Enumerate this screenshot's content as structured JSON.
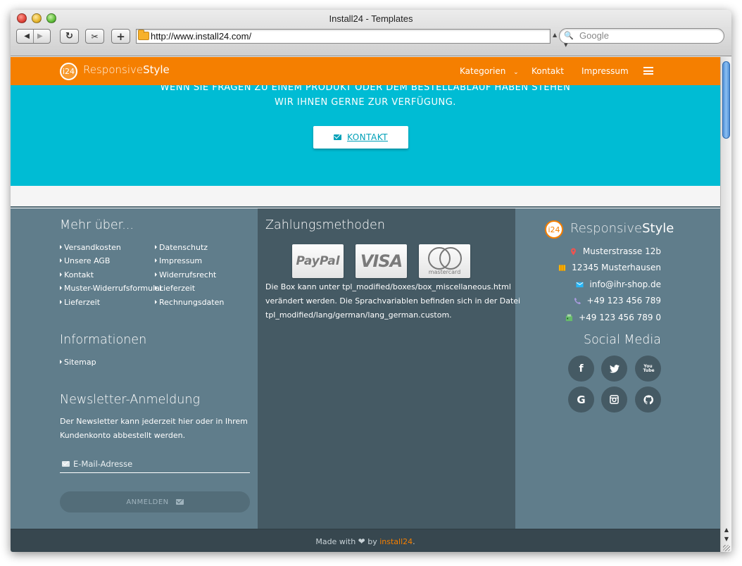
{
  "window": {
    "title": "Install24 - Templates",
    "url": "http://www.install24.com/",
    "search_placeholder": "Google"
  },
  "navbar": {
    "logo_text": "i24",
    "brand_light": "Responsive",
    "brand_bold": "Style",
    "links": {
      "kategorien": "Kategorien",
      "kontakt": "Kontakt",
      "impressum": "Impressum"
    }
  },
  "banner": {
    "line1": "WENN SIE FRAGEN ZU EINEM PRODUKT ODER DEM BESTELLABLAUF HABEN STEHEN",
    "line2": "WIR IHNEN GERNE ZUR VERFÜGUNG.",
    "button_label": "KONTAKT"
  },
  "footer": {
    "more": {
      "title": "Mehr über...",
      "links": [
        "Versandkosten",
        "Datenschutz",
        "Unsere AGB",
        "Impressum",
        "Kontakt",
        "Widerrufsrecht",
        "Muster-Widerrufsformular",
        "Lieferzeit",
        "Lieferzeit",
        "Rechnungsdaten"
      ]
    },
    "info": {
      "title": "Informationen",
      "links": [
        "Sitemap"
      ]
    },
    "newsletter": {
      "title": "Newsletter-Anmeldung",
      "text_line1": "Der Newsletter kann jederzeit hier oder in Ihrem",
      "text_line2": "Kundenkonto abbestellt werden.",
      "email_placeholder": "E-Mail-Adresse",
      "button_label": "ANMELDEN"
    },
    "payment": {
      "title": "Zahlungsmethoden",
      "logos": {
        "paypal": "PayPal",
        "visa": "VISA",
        "mastercard": "mastercard"
      },
      "text_line1": "Die Box kann unter tpl_modified/boxes/box_miscellaneous.html",
      "text_line2": "verändert werden. Die Sprachvariablen befinden sich in der Datei",
      "text_line3": "tpl_modified/lang/german/lang_german.custom."
    },
    "contact": {
      "logo_text": "i24",
      "brand_light": "Responsive",
      "brand_bold": "Style",
      "street": "Musterstrasse 12b",
      "city": "12345 Musterhausen",
      "email": "info@ihr-shop.de",
      "phone": "+49 123 456 789",
      "fax": "+49 123 456 789 0"
    },
    "social": {
      "title": "Social Media",
      "icons": [
        "facebook-icon",
        "twitter-icon",
        "youtube-icon",
        "google-icon",
        "instagram-icon",
        "github-icon"
      ],
      "glyphs": {
        "facebook": "f",
        "google": "G",
        "youtube": "You Tube"
      }
    },
    "bottom": {
      "made_with": "Made with",
      "by": "by",
      "link": "install24",
      "end": "."
    }
  },
  "colors": {
    "navbar": "#f57f00",
    "banner": "#00bcd4",
    "footer": "#607d8b",
    "footer_mid": "#455a64",
    "bottom_bar": "#37474f"
  }
}
